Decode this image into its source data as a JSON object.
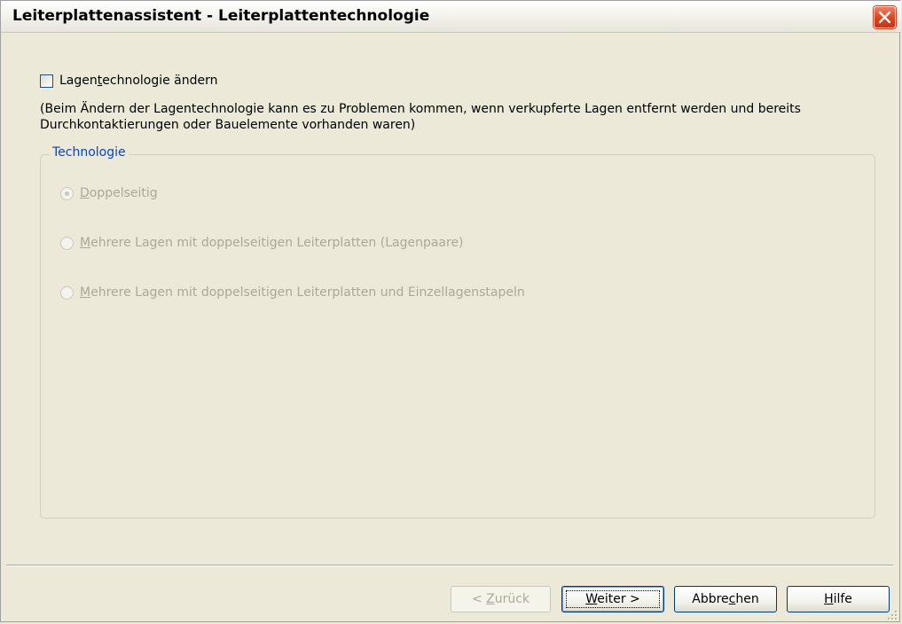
{
  "window": {
    "title": "Leiterplattenassistent - Leiterplattentechnologie"
  },
  "checkbox": {
    "label_pre": "Lagen",
    "label_u": "t",
    "label_post": "echnologie ändern",
    "checked": false
  },
  "note": "(Beim Ändern der Lagentechnologie kann es zu Problemen kommen, wenn verkupferte Lagen entfernt werden und bereits\nDurchkontaktierungen oder Bauelemente vorhanden waren)",
  "group": {
    "title": "Technologie",
    "options": [
      {
        "u": "D",
        "rest": "oppelseitig",
        "selected": true,
        "enabled": false
      },
      {
        "u": "M",
        "rest": "ehrere Lagen mit doppelseitigen Leiterplatten (Lagenpaare)",
        "selected": false,
        "enabled": false
      },
      {
        "u": "M",
        "rest": "ehrere Lagen mit doppelseitigen Leiterplatten und Einzellagenstapeln",
        "selected": false,
        "enabled": false
      }
    ]
  },
  "buttons": {
    "back": {
      "pre": "< ",
      "u": "Z",
      "post": "urück",
      "enabled": false
    },
    "next": {
      "pre": "",
      "u": "W",
      "post": "eiter >",
      "default": true
    },
    "cancel": {
      "pre": "Abbre",
      "u": "c",
      "post": "hen"
    },
    "help": {
      "pre": "",
      "u": "H",
      "post": "ilfe"
    }
  },
  "colors": {
    "group_title": "#0046d5",
    "disabled_text": "#aca899",
    "close_button": "#d9441c"
  }
}
